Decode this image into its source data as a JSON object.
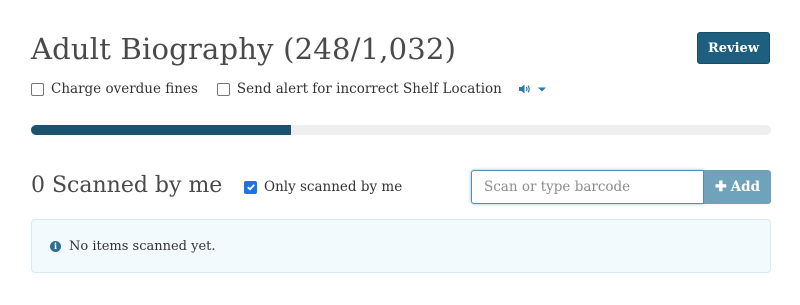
{
  "header": {
    "title": "Adult Biography (248/1,032)",
    "review_label": "Review"
  },
  "options": {
    "charge_fines_label": "Charge overdue fines",
    "charge_fines_checked": false,
    "shelf_alert_label": "Send alert for incorrect Shelf Location",
    "shelf_alert_checked": false,
    "sound_icon": "speaker-icon"
  },
  "progress": {
    "fraction": 0.3514,
    "color": "#1b5270"
  },
  "scanned": {
    "title": "0 Scanned by me",
    "only_mine_label": "Only scanned by me",
    "only_mine_checked": true
  },
  "barcode": {
    "placeholder": "Scan or type barcode",
    "value": "",
    "add_label": "Add"
  },
  "alert": {
    "message": "No items scanned yet."
  },
  "colors": {
    "primary": "#1e5f80",
    "add_button": "#6fa2bb",
    "alert_bg": "#f3fafd"
  }
}
